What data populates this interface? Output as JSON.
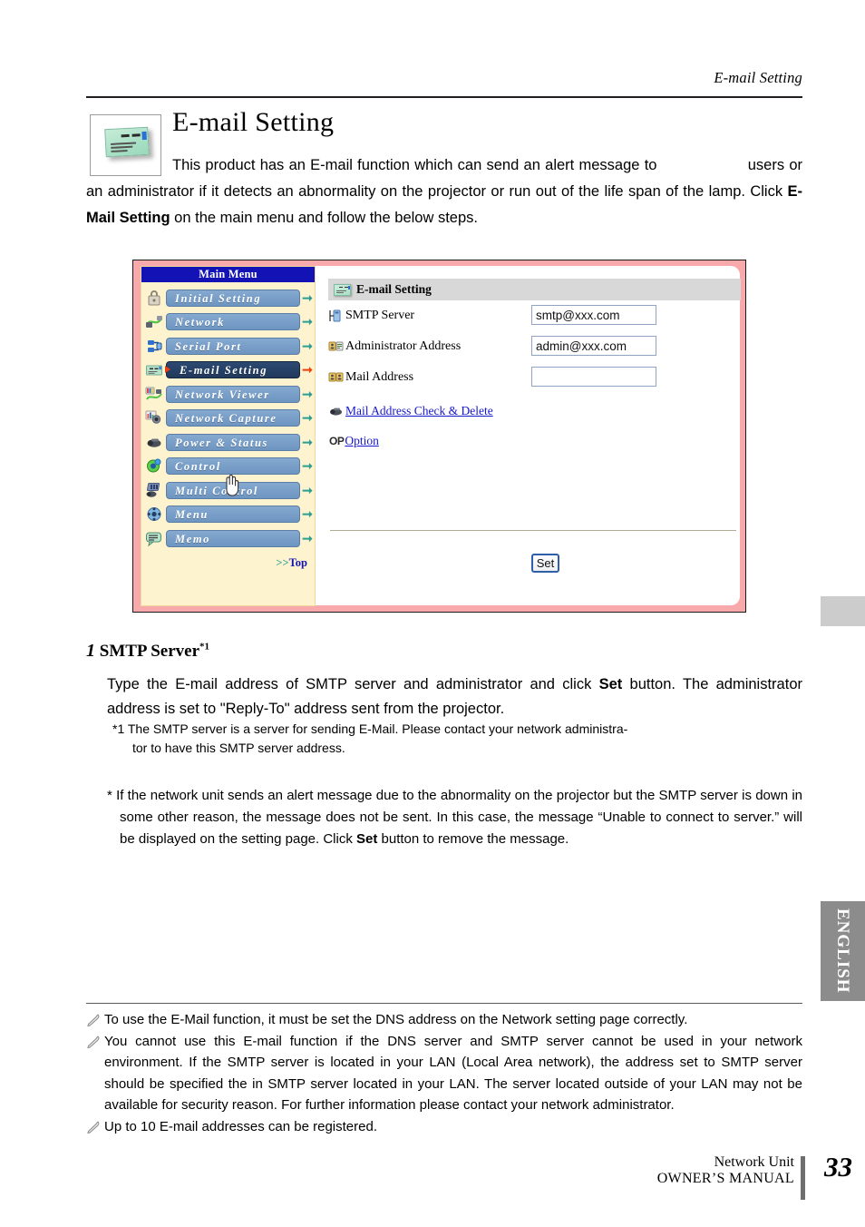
{
  "header": {
    "running_title": "E-mail Setting"
  },
  "title_block": {
    "icon": "envelope-icon",
    "heading": "E-mail Setting",
    "paragraph_part1": "This  product  has  an  E-mail  function  which  can  send  an  alert  message  to",
    "paragraph_part2": "users or an administrator if it detects an abnormality on the projector or run",
    "paragraph_part3a": "out of the life span of the lamp. Click ",
    "paragraph_bold": "E-Mail Setting",
    "paragraph_part3b": " on the main menu and follow the",
    "paragraph_part4": "below steps."
  },
  "screenshot": {
    "menu": {
      "title": "Main Menu",
      "items": [
        {
          "label": "Initial Setting",
          "icon": "padlock-icon",
          "selected": false
        },
        {
          "label": "Network",
          "icon": "network-cable-icon",
          "selected": false
        },
        {
          "label": "Serial Port",
          "icon": "serial-port-icon",
          "selected": false
        },
        {
          "label": "E-mail Setting",
          "icon": "envelope-icon",
          "selected": true
        },
        {
          "label": "Network Viewer",
          "icon": "network-viewer-icon",
          "selected": false
        },
        {
          "label": "Network Capture",
          "icon": "network-capture-icon",
          "selected": false
        },
        {
          "label": "Power & Status",
          "icon": "projector-icon",
          "selected": false
        },
        {
          "label": "Control",
          "icon": "control-icon",
          "selected": false
        },
        {
          "label": "Multi Control",
          "icon": "multi-control-icon",
          "selected": false
        },
        {
          "label": "Menu",
          "icon": "menu-wheel-icon",
          "selected": false
        },
        {
          "label": "Memo",
          "icon": "memo-icon",
          "selected": false
        }
      ],
      "top_link_prefix": ">>",
      "top_link": "Top",
      "cursor": "hand-cursor"
    },
    "panel": {
      "header_title": "E-mail Setting",
      "header_icon": "envelope-icon",
      "fields": [
        {
          "label": "SMTP Server",
          "icon": "smtp-server-icon",
          "value": "smtp@xxx.com",
          "placeholder": ""
        },
        {
          "label": "Administrator Address",
          "icon": "administrator-icon",
          "value": "admin@xxx.com",
          "placeholder": ""
        },
        {
          "label": "Mail Address",
          "icon": "mail-address-icon",
          "value": "",
          "placeholder": ""
        }
      ],
      "links": [
        {
          "label": "Mail Address Check & Delete",
          "icon": "projector-icon"
        },
        {
          "label": "Option",
          "icon": "op-badge-icon",
          "badge": "OP"
        }
      ],
      "set_button": "Set"
    }
  },
  "step1": {
    "number": "1",
    "heading": "SMTP Server",
    "heading_sup": "*1",
    "line1a": "Type  the  E-mail  address  of  SMTP  server  and  administrator  and  click  ",
    "line1_bold": "Set",
    "line1b": "  button.",
    "line2": "The administrator address is set to \"Reply-To\" address sent from the projector.",
    "footnote_line1": "*1 The SMTP server is a server for sending E-Mail. Please contact your network administra-",
    "footnote_line2": "tor to have this SMTP server address.",
    "note_a": "* If the network unit sends an alert message due to the abnormality on the projector but the SMTP server is down in some other reason, the message does not be sent. In this case, the message “Unable to connect to server.” will be displayed on the setting page. Click ",
    "note_a_bold": "Set",
    "note_a_end": " button to remove the message."
  },
  "notes": {
    "icon": "pen-note-icon",
    "items": [
      "To use the E-Mail function, it must be set the DNS address on the Network setting page correctly.",
      "You cannot use this E-mail function if the DNS server and SMTP server cannot be used in your network environment. If the SMTP server is located in your LAN (Local Area network), the address set to SMTP server should be specified the in SMTP server located in your LAN. The server located outside of your LAN may not be available for security reason. For further information please contact your network administrator.",
      "Up to 10 E-mail addresses can be registered."
    ]
  },
  "side_tabs": {
    "language": "ENGLISH"
  },
  "footer": {
    "line1": "Network Unit",
    "line2": "OWNER’S MANUAL",
    "page_number": "33"
  },
  "colors": {
    "menu_title_bg": "#1313b5",
    "menu_bg": "#fdf3cf",
    "menu_button": "#7aa0c9",
    "menu_selected": "#21395c",
    "frame_pink": "#f8a9ac",
    "link_blue": "#1515cc",
    "arrow_teal": "#2e9e92",
    "arrow_orange": "#f1410a",
    "tab_gray": "#8c8c8c"
  }
}
